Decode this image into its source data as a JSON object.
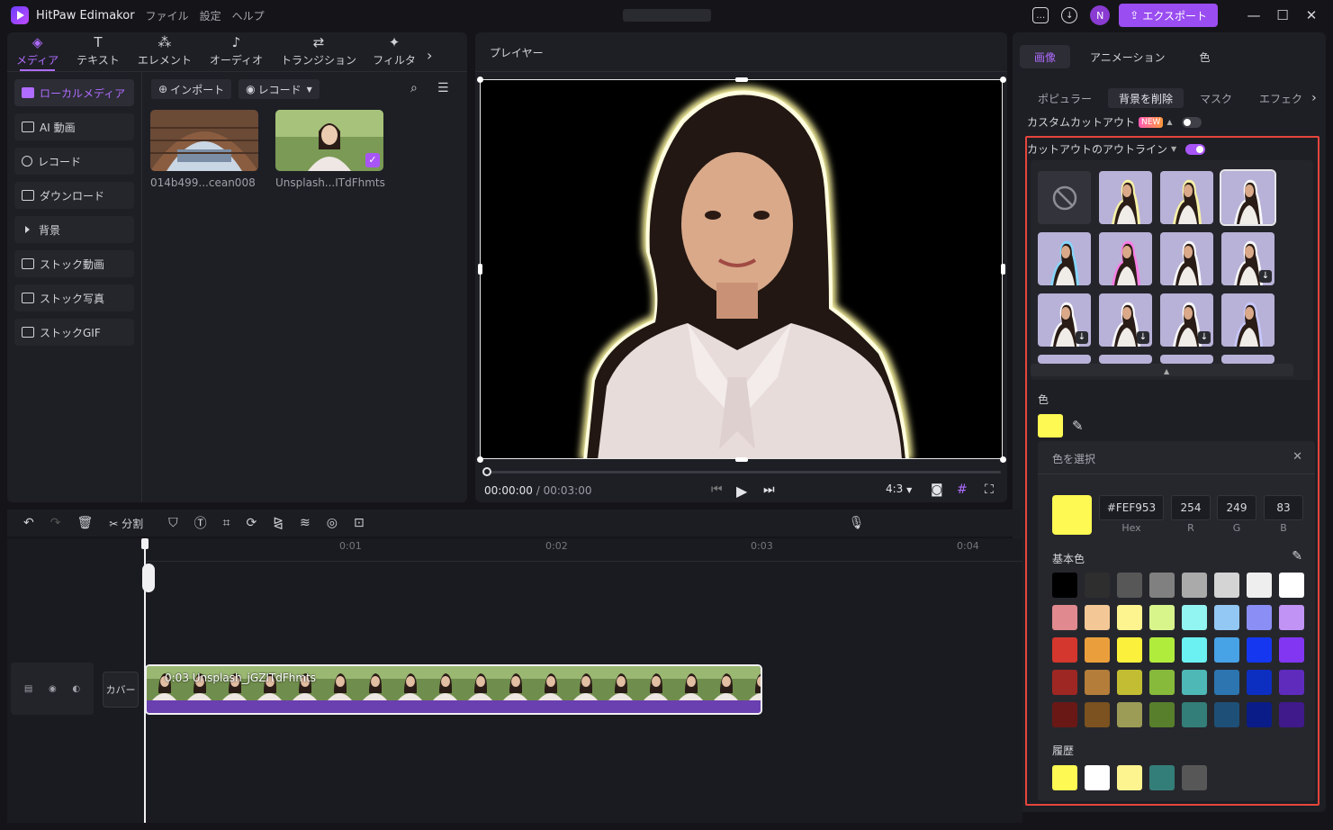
{
  "app": {
    "title": "HitPaw Edimakor",
    "menu": [
      "ファイル",
      "設定",
      "ヘルプ"
    ],
    "avatar_letter": "N",
    "export_label": "エクスポート"
  },
  "left_panel": {
    "tabs": [
      {
        "label": "メディア",
        "icon": "media-icon",
        "active": true
      },
      {
        "label": "テキスト",
        "icon": "text-icon"
      },
      {
        "label": "エレメント",
        "icon": "element-icon"
      },
      {
        "label": "オーディオ",
        "icon": "audio-icon"
      },
      {
        "label": "トランジション",
        "icon": "transition-icon"
      },
      {
        "label": "フィルタ",
        "icon": "filter-icon"
      }
    ],
    "sidebar": [
      {
        "label": "ローカルメディア",
        "active": true
      },
      {
        "label": "AI 動画"
      },
      {
        "label": "レコード"
      },
      {
        "label": "ダウンロード"
      },
      {
        "label": "背景"
      },
      {
        "label": "ストック動画"
      },
      {
        "label": "ストック写真"
      },
      {
        "label": "ストックGIF"
      }
    ],
    "import_label": "インポート",
    "record_label": "レコード",
    "media": [
      {
        "label": "014b499...cean008"
      },
      {
        "label": "Unsplash...ITdFhmts",
        "selected": true
      }
    ]
  },
  "player": {
    "title": "プレイヤー",
    "time_current": "00:00:00",
    "time_total": "/ 00:03:00",
    "ratio": "4:3"
  },
  "right_panel": {
    "tabs": [
      "画像",
      "アニメーション",
      "色"
    ],
    "subtabs": [
      "ポピュラー",
      "背景を削除",
      "マスク",
      "エフェク"
    ],
    "custom_cutout_label": "カスタムカットアウト",
    "new_badge": "NEW",
    "outline_label": "カットアウトのアウトライン",
    "color_label": "色",
    "picker": {
      "title": "色を選択",
      "hex": "#FEF953",
      "r": "254",
      "g": "249",
      "b": "83",
      "hex_label": "Hex",
      "r_label": "R",
      "g_label": "G",
      "b_label": "B",
      "basic_label": "基本色",
      "history_label": "履歴",
      "basic_colors": [
        [
          "#000000",
          "#2e2e2e",
          "#575757",
          "#808080",
          "#aaaaaa",
          "#d4d4d4",
          "#eeeeee",
          "#ffffff"
        ],
        [
          "#e08a8f",
          "#f4c896",
          "#fdf38f",
          "#d8f58c",
          "#93f5f1",
          "#94c8f4",
          "#8b8ef5",
          "#c193f5"
        ],
        [
          "#d4372d",
          "#eb9f3c",
          "#fbf03b",
          "#b0ec3c",
          "#6cf1f2",
          "#47a2e6",
          "#1537f0",
          "#8336f2"
        ],
        [
          "#9e2723",
          "#b47d3a",
          "#c3bd33",
          "#87b93a",
          "#4eb8b6",
          "#2c75b0",
          "#0c2ec1",
          "#5f2bbd"
        ],
        [
          "#6a1816",
          "#7b5220",
          "#9d9c57",
          "#587f2c",
          "#347e79",
          "#1e5077",
          "#0a1c87",
          "#40198a"
        ]
      ],
      "history_colors": [
        "#FEF953",
        "#ffffff",
        "#fdf38f",
        "#347e79",
        "#575757"
      ]
    }
  },
  "timeline": {
    "split_label": "分割",
    "ticks": [
      "0:01",
      "0:02",
      "0:03",
      "0:04"
    ],
    "cover_label": "カバー",
    "clip_label": "0:03 Unsplash_jGZITdFhmts"
  }
}
